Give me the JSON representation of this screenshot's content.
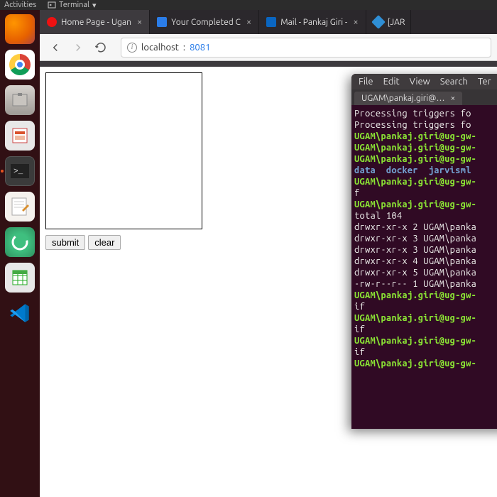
{
  "topbar": {
    "activities": "Activities",
    "terminal": "Terminal"
  },
  "dock": {
    "items": [
      {
        "name": "firefox-app",
        "label": "Firefox"
      },
      {
        "name": "chrome-app",
        "label": "Chrome"
      },
      {
        "name": "files-app",
        "label": "Files"
      },
      {
        "name": "impress-app",
        "label": "LibreOffice Impress"
      },
      {
        "name": "terminal-app",
        "label": "Terminal"
      },
      {
        "name": "gedit-app",
        "label": "Text Editor"
      },
      {
        "name": "vpn-app",
        "label": "Cisco AnyConnect"
      },
      {
        "name": "calc-app",
        "label": "LibreOffice Calc"
      },
      {
        "name": "vscode-app",
        "label": "VS Code"
      }
    ]
  },
  "fftabs": [
    {
      "label": "Home Page - Ugan",
      "fav": "#e11"
    },
    {
      "label": "Your Completed C",
      "fav": "#2b7de9"
    },
    {
      "label": "Mail - Pankaj Giri -",
      "fav": "#0a66c2"
    },
    {
      "label": "[JAR",
      "fav": "#2f8fd6"
    }
  ],
  "url": {
    "host": "localhost",
    "port": "8081"
  },
  "page_btns": {
    "submit": "submit",
    "clear": "clear"
  },
  "terminal": {
    "menu": [
      "File",
      "Edit",
      "View",
      "Search",
      "Ter"
    ],
    "tab": "UGAM\\pankaj.giri@…",
    "lines": [
      {
        "t": "Processing triggers fo",
        "c": "w"
      },
      {
        "t": "Processing triggers fo",
        "c": "w"
      },
      {
        "t": "UGAM\\pankaj.giri@ug-gw-",
        "c": "g"
      },
      {
        "t": "UGAM\\pankaj.giri@ug-gw-",
        "c": "g"
      },
      {
        "t": "UGAM\\pankaj.giri@ug-gw-",
        "c": "g"
      },
      {
        "t": "data  docker  jarvisml",
        "c": "b"
      },
      {
        "t": "UGAM\\pankaj.giri@ug-gw-",
        "c": "g"
      },
      {
        "t": "f",
        "c": "w"
      },
      {
        "t": "UGAM\\pankaj.giri@ug-gw-",
        "c": "g"
      },
      {
        "t": "total 104",
        "c": "w"
      },
      {
        "t": "drwxr-xr-x 2 UGAM\\panka",
        "c": "w"
      },
      {
        "t": "drwxr-xr-x 3 UGAM\\panka",
        "c": "w"
      },
      {
        "t": "drwxr-xr-x 3 UGAM\\panka",
        "c": "w"
      },
      {
        "t": "drwxr-xr-x 4 UGAM\\panka",
        "c": "w"
      },
      {
        "t": "drwxr-xr-x 5 UGAM\\panka",
        "c": "w"
      },
      {
        "t": "-rw-r--r-- 1 UGAM\\panka",
        "c": "w"
      },
      {
        "t": "UGAM\\pankaj.giri@ug-gw-",
        "c": "g"
      },
      {
        "t": "if",
        "c": "w"
      },
      {
        "t": "UGAM\\pankaj.giri@ug-gw-",
        "c": "g"
      },
      {
        "t": "if",
        "c": "w"
      },
      {
        "t": "UGAM\\pankaj.giri@ug-gw-",
        "c": "g"
      },
      {
        "t": "if",
        "c": "w"
      },
      {
        "t": "UGAM\\pankaj.giri@ug-gw-",
        "c": "g"
      }
    ]
  }
}
